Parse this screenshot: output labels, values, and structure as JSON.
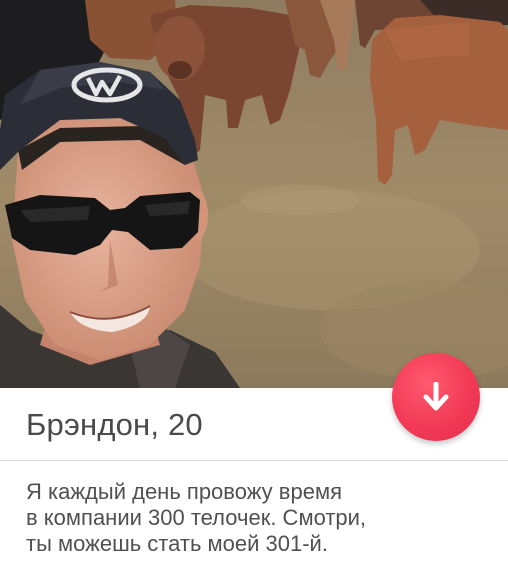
{
  "profile": {
    "name_age": "Брэндон, 20",
    "bio_lines": [
      "Я каждый день провожу время",
      "в компании 300 телочек. Смотри,",
      "ты можешь стать моей 301-й."
    ]
  },
  "photo": {
    "subject": "selfie-with-cattle"
  },
  "actions": {
    "expand_icon": "arrow-down-icon"
  },
  "colors": {
    "fab": "#f23a57",
    "name_text": "#4a4a4a",
    "bio_text": "#505050",
    "divider": "#dcdcdc"
  }
}
